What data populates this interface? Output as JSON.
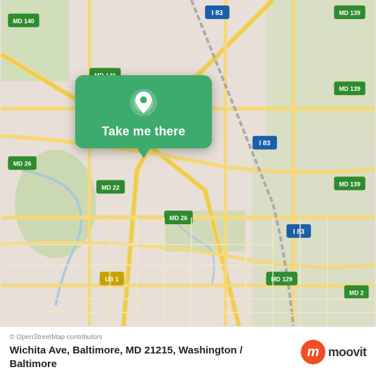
{
  "map": {
    "background_color": "#e8e0d8",
    "alt": "Street map of Baltimore MD area"
  },
  "popup": {
    "label": "Take me there",
    "pin_icon": "location-pin"
  },
  "bottom_bar": {
    "osm_credit": "© OpenStreetMap contributors",
    "address": "Wichita Ave, Baltimore, MD 21215, Washington /\nBaltimore",
    "moovit_brand": "moovit"
  }
}
